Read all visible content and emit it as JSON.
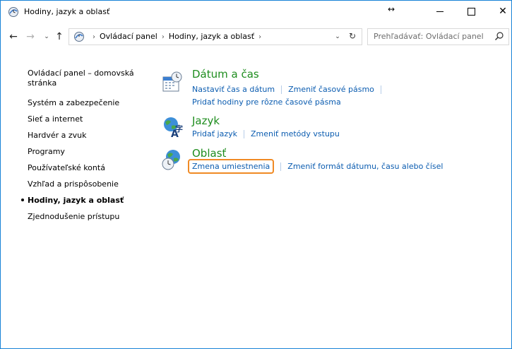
{
  "window": {
    "title": "Hodiny, jazyk a oblasť",
    "resize_glyph": "↔",
    "close_glyph": "✕"
  },
  "nav": {
    "back_icon": "arrow-left-icon",
    "forward_icon": "arrow-right-icon",
    "recent_icon": "chevron-down-icon",
    "up_icon": "arrow-up-icon",
    "back_glyph": "←",
    "forward_glyph": "→",
    "recent_glyph": "⌄",
    "up_glyph": "↑",
    "dropdown_glyph": "⌄",
    "refresh_glyph": "↻",
    "sep_glyph": "›",
    "breadcrumbs": [
      "Ovládací panel",
      "Hodiny, jazyk a oblasť"
    ],
    "search_placeholder": "Prehľadávať: Ovládací panel"
  },
  "sidebar": {
    "items": [
      {
        "label": "Ovládací panel – domovská stránka"
      },
      {
        "label": "Systém a zabezpečenie"
      },
      {
        "label": "Sieť a internet"
      },
      {
        "label": "Hardvér a zvuk"
      },
      {
        "label": "Programy"
      },
      {
        "label": "Používateľské kontá"
      },
      {
        "label": "Vzhľad a prispôsobenie"
      },
      {
        "label": "Hodiny, jazyk a oblasť",
        "active": true
      },
      {
        "label": "Zjednodušenie prístupu"
      }
    ],
    "home_line1": "Ovládací panel – domovská",
    "home_line2": "stránka"
  },
  "categories": {
    "datetime": {
      "title": "Dátum a čas",
      "link1": "Nastaviť čas a dátum",
      "link2": "Zmeniť časové pásmo",
      "link3": "Pridať hodiny pre rôzne časové pásma"
    },
    "language": {
      "title": "Jazyk",
      "link1": "Pridať jazyk",
      "link2": "Zmeniť metódy vstupu"
    },
    "region": {
      "title": "Oblasť",
      "link1": "Zmena umiestnenia",
      "link2": "Zmeniť formát dátumu, času alebo čísel"
    }
  },
  "colors": {
    "category_title": "#1e8d1e",
    "link": "#0b5cb0",
    "highlight": "#f08a24",
    "window_border": "#1883d7"
  }
}
